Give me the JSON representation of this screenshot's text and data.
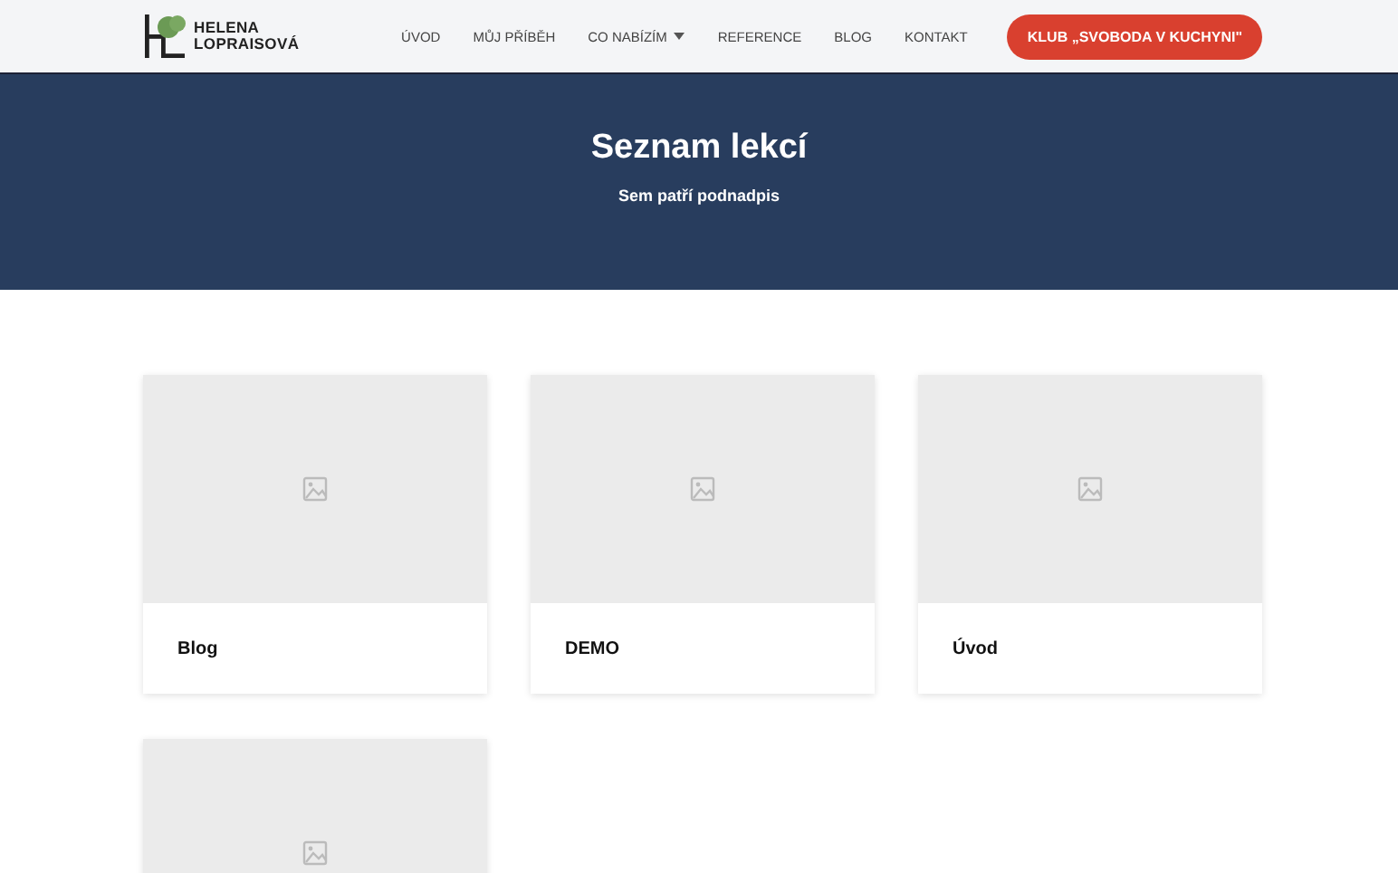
{
  "header": {
    "brand": [
      "HELENA",
      "LOPRAISOVÁ"
    ],
    "nav": [
      {
        "label": "ÚVOD",
        "dropdown": false
      },
      {
        "label": "MŮJ PŘÍBĚH",
        "dropdown": false
      },
      {
        "label": "CO NABÍZÍM",
        "dropdown": true
      },
      {
        "label": "REFERENCE",
        "dropdown": false
      },
      {
        "label": "BLOG",
        "dropdown": false
      },
      {
        "label": "KONTAKT",
        "dropdown": false
      }
    ],
    "cta": "KLUB „SVOBODA V KUCHYNI\""
  },
  "hero": {
    "title": "Seznam lekcí",
    "subtitle": "Sem patří podnadpis"
  },
  "lessons": [
    {
      "kind": "titled",
      "title": "Blog"
    },
    {
      "kind": "titled",
      "title": "DEMO"
    },
    {
      "kind": "titled",
      "title": "Úvod"
    },
    {
      "kind": "cut"
    }
  ]
}
